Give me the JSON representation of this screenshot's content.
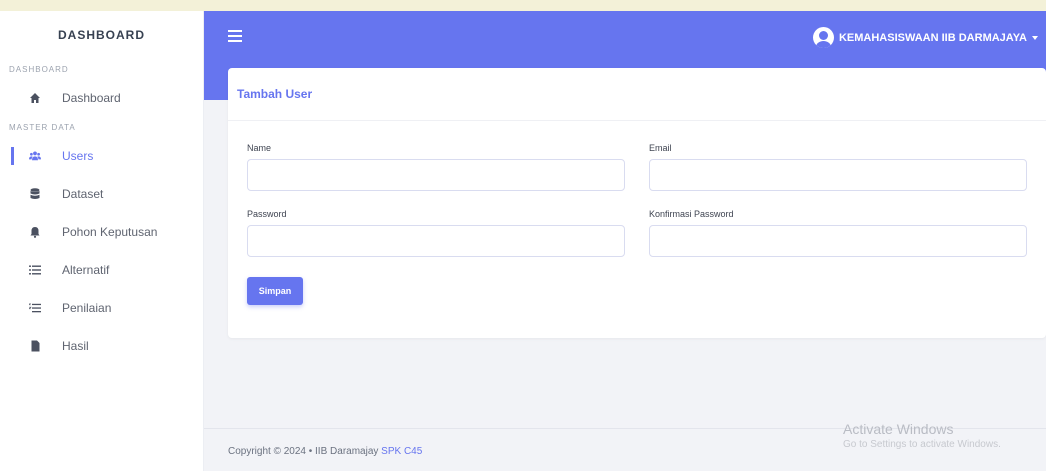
{
  "sidebar": {
    "brand": "DASHBOARD",
    "sections": [
      {
        "heading": "DASHBOARD"
      },
      {
        "heading": "MASTER DATA"
      }
    ],
    "items": [
      {
        "label": "Dashboard",
        "icon": "home-icon"
      },
      {
        "label": "Users",
        "icon": "users-icon",
        "active": true
      },
      {
        "label": "Dataset",
        "icon": "database-icon"
      },
      {
        "label": "Pohon Keputusan",
        "icon": "bell-icon"
      },
      {
        "label": "Alternatif",
        "icon": "list-icon"
      },
      {
        "label": "Penilaian",
        "icon": "numbered-list-icon"
      },
      {
        "label": "Hasil",
        "icon": "file-icon"
      }
    ]
  },
  "topbar": {
    "menu_icon": "hamburger-icon",
    "user_name": "KEMAHASISWAAN IIB DARMAJAYA",
    "avatar_icon": "user-avatar-icon",
    "caret_icon": "caret-down-icon"
  },
  "form": {
    "title": "Tambah User",
    "fields": {
      "name": {
        "label": "Name",
        "value": "",
        "placeholder": ""
      },
      "email": {
        "label": "Email",
        "value": "",
        "placeholder": ""
      },
      "password": {
        "label": "Password",
        "value": "",
        "placeholder": ""
      },
      "confirm": {
        "label": "Konfirmasi Password",
        "value": "",
        "placeholder": ""
      }
    },
    "submit_label": "Simpan"
  },
  "footer": {
    "text": "Copyright © 2024  •  IIB Daramajay",
    "link": "SPK C45"
  },
  "watermark": {
    "line1": "Activate Windows",
    "line2": "Go to Settings to activate Windows."
  },
  "colors": {
    "accent": "#6675ef",
    "background": "#f2f3f7"
  }
}
